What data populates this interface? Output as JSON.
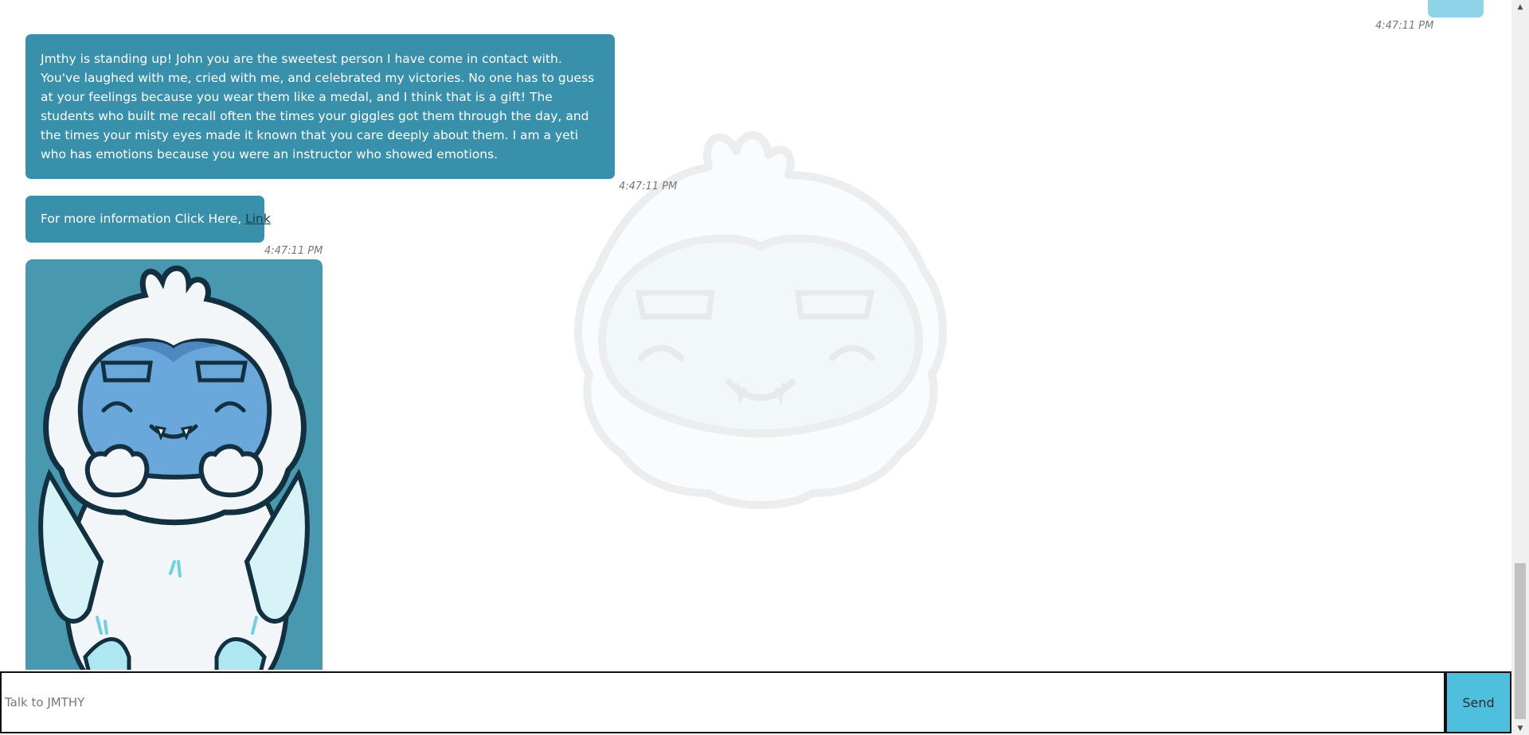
{
  "chat": {
    "messages": [
      {
        "sender": "user",
        "timestamp": "4:47:11 PM"
      },
      {
        "sender": "bot",
        "text": "Jmthy is standing up! John you are the sweetest person I have come in contact with. You've laughed with me, cried with me, and celebrated my victories. No one has to guess at your feelings because you wear them like a medal, and I think that is a gift! The students who built me recall often the times your giggles got them through the day, and the times your misty eyes made it known that you care deeply about them. I am a yeti who has emotions because you were an instructor who showed emotions.",
        "timestamp": "4:47:11 PM"
      },
      {
        "sender": "bot",
        "text": "For more information Click Here, ",
        "link_text": "Link",
        "timestamp": "4:47:11 PM"
      },
      {
        "sender": "bot",
        "image": "yeti-mascot"
      }
    ]
  },
  "input": {
    "placeholder": "Talk to JMTHY",
    "value": ""
  },
  "send_button": {
    "label": "Send"
  },
  "colors": {
    "bot_bubble": "#3890ab",
    "user_bubble": "#8fd3e8",
    "send_button": "#4ebfdc",
    "image_background": "#4898b0"
  },
  "icons": {
    "watermark": "yeti-face-watermark",
    "scroll_up": "scroll-up-arrow",
    "scroll_down": "scroll-down-arrow"
  }
}
